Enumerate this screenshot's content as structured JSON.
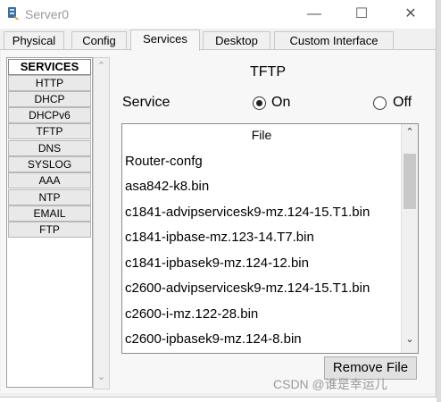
{
  "window": {
    "title": "Server0",
    "minimize_glyph": "—",
    "maximize_glyph": "☐",
    "close_glyph": "✕"
  },
  "tabs": [
    {
      "label": "Physical",
      "active": false
    },
    {
      "label": "Config",
      "active": false
    },
    {
      "label": "Services",
      "active": true
    },
    {
      "label": "Desktop",
      "active": false
    },
    {
      "label": "Custom Interface",
      "active": false
    }
  ],
  "services": {
    "header": "SERVICES",
    "items": [
      "HTTP",
      "DHCP",
      "DHCPv6",
      "TFTP",
      "DNS",
      "SYSLOG",
      "AAA",
      "NTP",
      "EMAIL",
      "FTP"
    ]
  },
  "panel": {
    "title": "TFTP",
    "service_label": "Service",
    "on_label": "On",
    "off_label": "Off",
    "selected": "On"
  },
  "file_list": {
    "header": "File",
    "files": [
      "Router-confg",
      "asa842-k8.bin",
      "c1841-advipservicesk9-mz.124-15.T1.bin",
      "c1841-ipbase-mz.123-14.T7.bin",
      "c1841-ipbasek9-mz.124-12.bin",
      "c2600-advipservicesk9-mz.124-15.T1.bin",
      "c2600-i-mz.122-28.bin",
      "c2600-ipbasek9-mz.124-8.bin"
    ],
    "scroll_up_glyph": "⌃",
    "scroll_down_glyph": "⌄"
  },
  "remove_button": "Remove File",
  "watermark": "CSDN @谁是幸运儿"
}
